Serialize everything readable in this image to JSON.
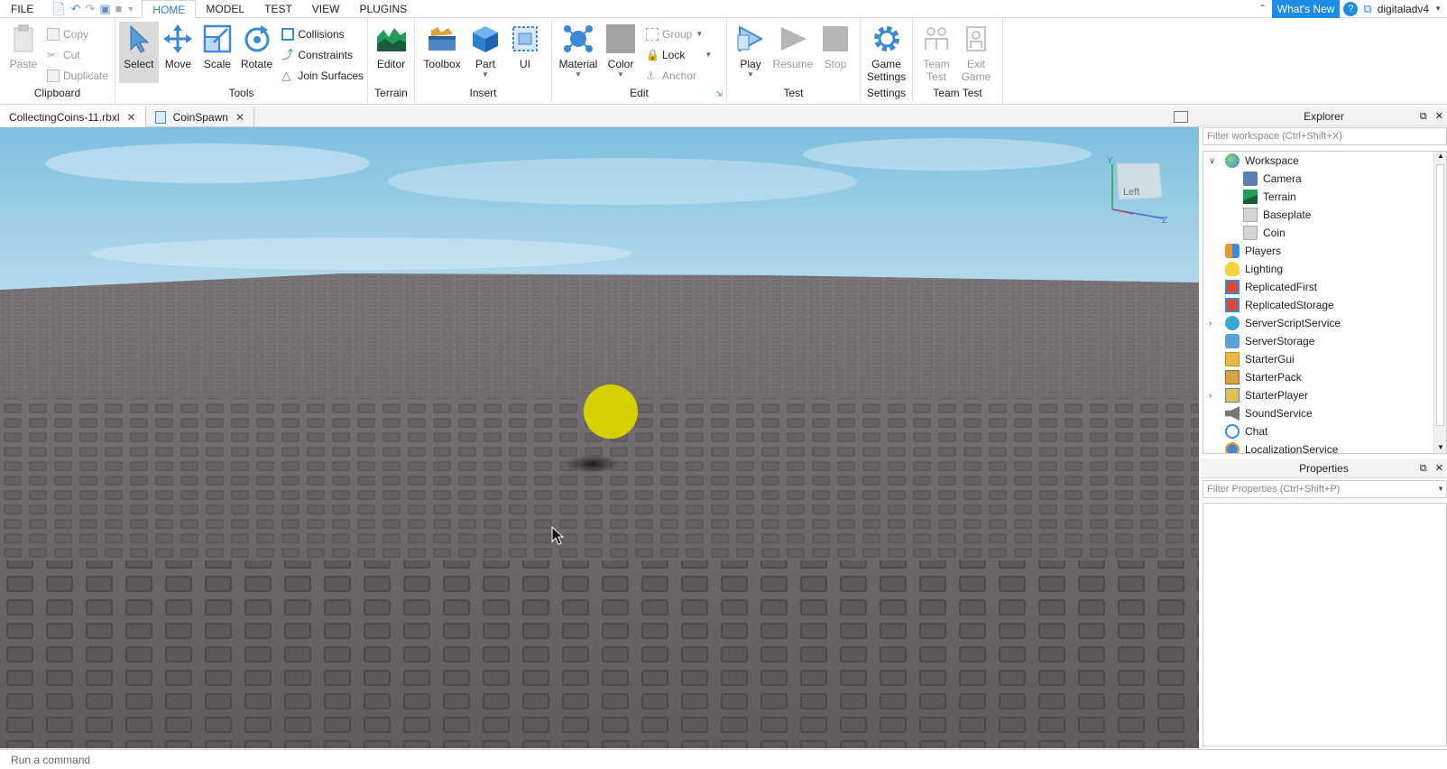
{
  "menubar": {
    "file": "FILE",
    "tabs": [
      "HOME",
      "MODEL",
      "TEST",
      "VIEW",
      "PLUGINS"
    ],
    "whats_new": "What's New",
    "username": "digitaladv4"
  },
  "ribbon": {
    "clipboard": {
      "label": "Clipboard",
      "paste": "Paste",
      "copy": "Copy",
      "cut": "Cut",
      "duplicate": "Duplicate"
    },
    "tools": {
      "label": "Tools",
      "select": "Select",
      "move": "Move",
      "scale": "Scale",
      "rotate": "Rotate",
      "collisions": "Collisions",
      "constraints": "Constraints",
      "join_surfaces": "Join Surfaces"
    },
    "terrain": {
      "label": "Terrain",
      "editor": "Editor"
    },
    "insert": {
      "label": "Insert",
      "toolbox": "Toolbox",
      "part": "Part",
      "ui": "UI"
    },
    "edit": {
      "label": "Edit",
      "material": "Material",
      "color": "Color",
      "group": "Group",
      "lock": "Lock",
      "anchor": "Anchor"
    },
    "test": {
      "label": "Test",
      "play": "Play",
      "resume": "Resume",
      "stop": "Stop"
    },
    "settings": {
      "label": "Settings",
      "game_settings_1": "Game",
      "game_settings_2": "Settings"
    },
    "team_test": {
      "label": "Team Test",
      "team_1": "Team",
      "team_2": "Test",
      "exit_1": "Exit",
      "exit_2": "Game"
    }
  },
  "doc_tabs": [
    {
      "label": "CollectingCoins-11.rbxl"
    },
    {
      "label": "CoinSpawn"
    }
  ],
  "viewport": {
    "view_cube_label": "Left",
    "axis_y": "Y",
    "axis_z": "Z"
  },
  "explorer": {
    "title": "Explorer",
    "filter_placeholder": "Filter workspace (Ctrl+Shift+X)",
    "items": [
      {
        "label": "Workspace",
        "icon": "globe-icon",
        "level": 0,
        "expander": "expanded"
      },
      {
        "label": "Camera",
        "icon": "camera-icon",
        "level": 1,
        "expander": "none"
      },
      {
        "label": "Terrain",
        "icon": "terrain-icon",
        "level": 1,
        "expander": "none"
      },
      {
        "label": "Baseplate",
        "icon": "part-icon",
        "level": 1,
        "expander": "none"
      },
      {
        "label": "Coin",
        "icon": "part-icon",
        "level": 1,
        "expander": "none"
      },
      {
        "label": "Players",
        "icon": "players-icon",
        "level": 0,
        "expander": "none"
      },
      {
        "label": "Lighting",
        "icon": "lightbulb-icon",
        "level": 0,
        "expander": "none"
      },
      {
        "label": "ReplicatedFirst",
        "icon": "replicated-first-icon",
        "level": 0,
        "expander": "none"
      },
      {
        "label": "ReplicatedStorage",
        "icon": "replicated-storage-icon",
        "level": 0,
        "expander": "none"
      },
      {
        "label": "ServerScriptService",
        "icon": "server-script-service-icon",
        "level": 0,
        "expander": "collapsed"
      },
      {
        "label": "ServerStorage",
        "icon": "server-storage-icon",
        "level": 0,
        "expander": "none"
      },
      {
        "label": "StarterGui",
        "icon": "starter-gui-icon",
        "level": 0,
        "expander": "none"
      },
      {
        "label": "StarterPack",
        "icon": "starter-pack-icon",
        "level": 0,
        "expander": "none"
      },
      {
        "label": "StarterPlayer",
        "icon": "starter-player-icon",
        "level": 0,
        "expander": "collapsed"
      },
      {
        "label": "SoundService",
        "icon": "speaker-icon",
        "level": 0,
        "expander": "none"
      },
      {
        "label": "Chat",
        "icon": "chat-icon",
        "level": 0,
        "expander": "none"
      },
      {
        "label": "LocalizationService",
        "icon": "localization-icon",
        "level": 0,
        "expander": "none"
      }
    ]
  },
  "properties": {
    "title": "Properties",
    "filter_placeholder": "Filter Properties (Ctrl+Shift+P)"
  },
  "command_bar": {
    "placeholder": "Run a command"
  },
  "colors": {
    "accent": "#1c8ce6",
    "coin": "#d6d000",
    "sky": "#8fc6e2",
    "ground": "#6b6669"
  }
}
